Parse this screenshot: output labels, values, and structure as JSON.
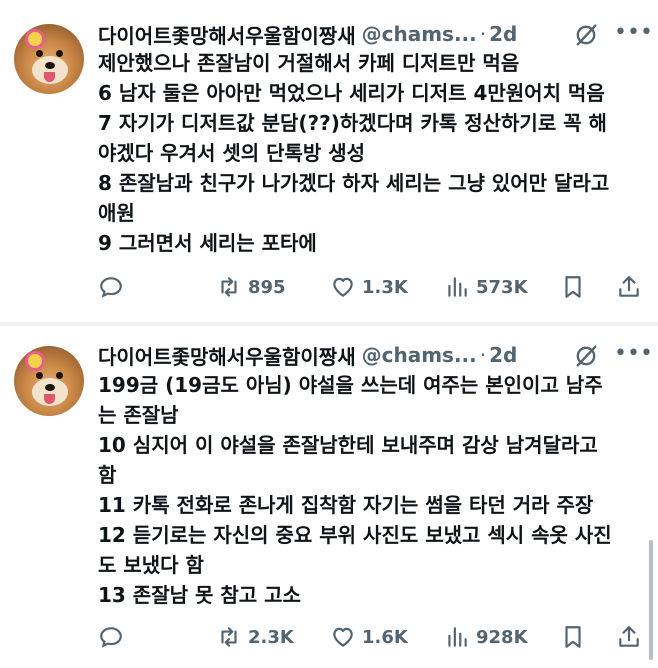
{
  "tweets": [
    {
      "author_name": "다이어트좇망해서우울함이짱새",
      "handle": "@chams...",
      "separator": "·",
      "time": "2d",
      "lines": [
        "제안했으나 존잘남이 거절해서 카페 디저트만 먹음",
        "6 남자 둘은 아아만 먹었으나 세리가 디저트 4만원어치 먹음",
        "7 자기가 디저트값 분담(??)하겠다며 카톡 정산하기로 꼭 해",
        "야겠다 우겨서 셋의 단톡방 생성",
        "8 존잘남과 친구가 나가겠다 하자 세리는 그냥 있어만 달라고",
        "애원",
        "9 그러면서 세리는 포타에"
      ],
      "stats": {
        "retweets": "895",
        "likes": "1.3K",
        "views": "573K"
      }
    },
    {
      "author_name": "다이어트좇망해서우울함이짱새",
      "handle": "@chams...",
      "separator": "·",
      "time": "2d",
      "lines": [
        "199금 (19금도 아님) 야설을 쓰는데 여주는 본인이고 남주",
        "는 존잘남",
        "10 심지어 이 야설을 존잘남한테 보내주며 감상 남겨달라고",
        "함",
        "11 카톡 전화로 존나게 집착함 자기는 썸을 타던 거라 주장",
        "12 듣기로는 자신의 중요 부위 사진도 보냈고 섹시 속옷 사진",
        "도 보냈다 함",
        "13 존잘남 못 참고 고소"
      ],
      "stats": {
        "retweets": "2.3K",
        "likes": "1.6K",
        "views": "928K"
      }
    }
  ],
  "icons": {
    "reply": "reply-icon",
    "retweet": "retweet-icon",
    "like": "heart-icon",
    "views": "views-icon",
    "bookmark": "bookmark-icon",
    "share": "share-icon",
    "grok": "grok-icon",
    "more": "more-icon"
  },
  "colors": {
    "text": "#0f1419",
    "secondary": "#536471",
    "divider": "#eff3f4"
  }
}
